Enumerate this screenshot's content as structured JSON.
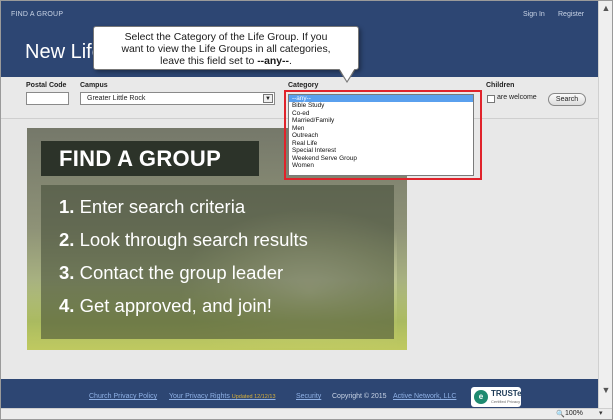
{
  "header": {
    "nav_left": "FIND A GROUP",
    "sign_in": "Sign In",
    "register": "Register",
    "title": "New Life"
  },
  "filters": {
    "postal_code_label": "Postal Code",
    "campus_label": "Campus",
    "campus_value": "Greater Little Rock",
    "category_label": "Category",
    "children_label": "Children",
    "children_option": "are welcome",
    "search_button": "Search"
  },
  "category_options": [
    "--any--",
    "Bible Study",
    "Co-ed",
    "Married/Family",
    "Men",
    "Outreach",
    "Real Life",
    "Special Interest",
    "Weekend Serve Group",
    "Women"
  ],
  "callout": {
    "line1": "Select the Category of the Life Group.  If you",
    "line2": "want to view the Life Groups in all categories,",
    "line3_pre": "leave this field set to ",
    "line3_bold": "--any--",
    "line3_post": "."
  },
  "promo": {
    "heading": "FIND A GROUP",
    "steps": [
      {
        "num": "1.",
        "text": " Enter search criteria"
      },
      {
        "num": "2.",
        "text": " Look through search results"
      },
      {
        "num": "3.",
        "text": " Contact the group leader"
      },
      {
        "num": "4.",
        "text": " Get approved, and join!"
      }
    ]
  },
  "footer": {
    "privacy_policy": "Church Privacy Policy",
    "privacy_rights": "Your Privacy Rights",
    "updated": "Updated 12/12/13",
    "security": "Security",
    "copyright": "Copyright © 2015",
    "active_network": "Active Network, LLC",
    "truste_name": "TRUSTe",
    "truste_sub": "Certified Privacy"
  },
  "status": {
    "zoom": "100%"
  },
  "colors": {
    "header_bg": "#2d4673",
    "highlight": "#e0232b",
    "selected_option": "#5aa0ee"
  },
  "icons": [
    "truste-logo-icon",
    "checkbox-icon",
    "dropdown-arrow-icon",
    "scroll-up-icon",
    "scroll-down-icon",
    "zoom-icon"
  ]
}
